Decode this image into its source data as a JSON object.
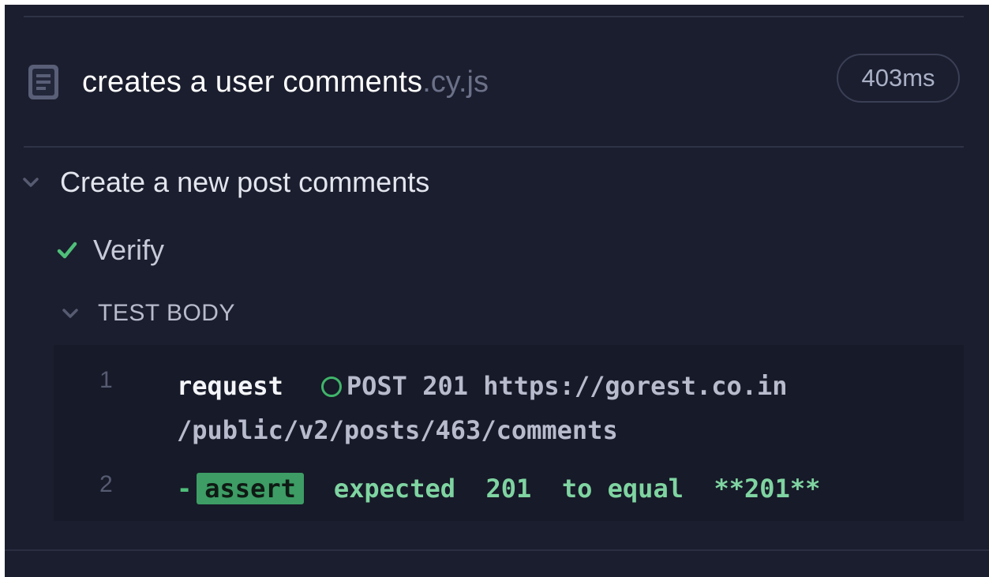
{
  "spec": {
    "name": "creates a user comments",
    "extension": ".cy.js",
    "duration": "403ms"
  },
  "suite": {
    "title": "Create a new post comments"
  },
  "test": {
    "title": "Verify",
    "status_color": "#4fbf7a"
  },
  "section": {
    "title": "TEST BODY"
  },
  "commands": [
    {
      "number": "1",
      "name": "request",
      "message": "POST 201 https://gorest.co.in\n/public/v2/posts/463/comments",
      "status_color": "#3fb56a"
    },
    {
      "number": "2",
      "prefix": "-",
      "name": "assert",
      "message": "expected  201  to equal  **201**",
      "badge_color": "#3d9d65"
    }
  ],
  "colors": {
    "background": "#1b1e2e",
    "log_background": "#171a28",
    "accent_green": "#4fbf7a"
  }
}
